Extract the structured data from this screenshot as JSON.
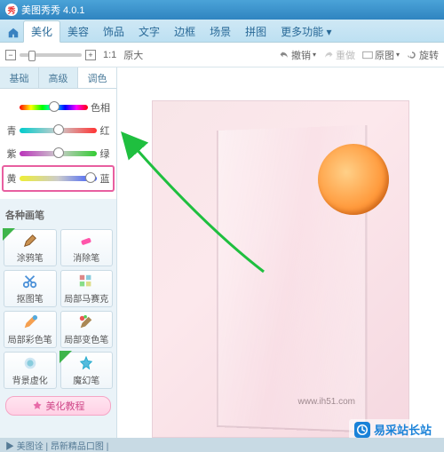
{
  "app": {
    "title": "美图秀秀 4.0.1",
    "logo_glyph": "秀"
  },
  "main_tabs": {
    "items": [
      "美化",
      "美容",
      "饰品",
      "文字",
      "边框",
      "场景",
      "拼图"
    ],
    "active": "美化",
    "more": "更多功能 ▾"
  },
  "toolbar2": {
    "zoom11": "1:1",
    "zoom_orig": "原大",
    "undo": "撤销",
    "redo": "重做",
    "original": "原图",
    "rotate": "旋转"
  },
  "side_tabs": {
    "items": [
      "基础",
      "高级",
      "调色"
    ],
    "active": "调色"
  },
  "sliders": {
    "hue": {
      "left": "",
      "right": "色相",
      "pos": 50
    },
    "cyan_red": {
      "left": "青",
      "right": "红",
      "pos": 50
    },
    "purple_green": {
      "left": "紫",
      "right": "绿",
      "pos": 50
    },
    "yellow_blue": {
      "left": "黄",
      "right": "蓝",
      "pos": 92
    }
  },
  "brush_section": {
    "title": "各种画笔"
  },
  "brushes": [
    {
      "label": "涂鸦笔",
      "icon": "pen",
      "ribbon": "green"
    },
    {
      "label": "消除笔",
      "icon": "eraser"
    },
    {
      "label": "抠图笔",
      "icon": "scissors"
    },
    {
      "label": "局部马赛克",
      "icon": "mosaic"
    },
    {
      "label": "局部彩色笔",
      "icon": "color-pen"
    },
    {
      "label": "局部变色笔",
      "icon": "recolor"
    },
    {
      "label": "背景虚化",
      "icon": "blur"
    },
    {
      "label": "魔幻笔",
      "icon": "magic",
      "ribbon": "green-new"
    }
  ],
  "tutorial": "美化教程",
  "footer": "▶ 美图诠 | 昂新精品口图 |",
  "watermark": {
    "text": "易采站长站",
    "url": "www.ih51.com"
  },
  "colors": {
    "accent": "#2f84c0",
    "highlight": "#e85fa0"
  }
}
